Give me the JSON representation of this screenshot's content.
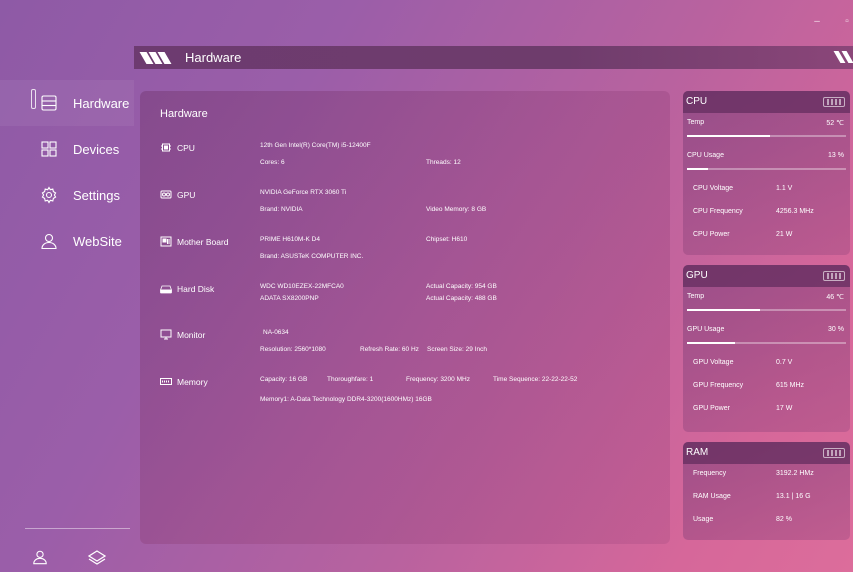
{
  "window": {
    "minimize_glyph": "–",
    "maximize_glyph": "▫"
  },
  "header": {
    "title": "Hardware"
  },
  "sidebar": {
    "items": [
      {
        "label": "Hardware",
        "icon": "hardware-icon",
        "active": true
      },
      {
        "label": "Devices",
        "icon": "devices-grid-icon"
      },
      {
        "label": "Settings",
        "icon": "gear-icon"
      },
      {
        "label": "WebSite",
        "icon": "user-icon"
      }
    ],
    "bottom_icons": [
      "user-icon",
      "layers-icon"
    ]
  },
  "main": {
    "title": "Hardware",
    "cpu": {
      "name": "CPU",
      "model": "12th Gen Intel(R) Core(TM) i5-12400F",
      "cores": "Cores: 6",
      "threads": "Threads: 12"
    },
    "gpu": {
      "name": "GPU",
      "model": "NVIDIA GeForce RTX 3060 Ti",
      "brand": "Brand: NVIDIA",
      "vram": "Video Memory: 8 GB"
    },
    "board": {
      "name": "Mother Board",
      "model": "PRIME H610M-K D4",
      "chipset": "Chipset: H610",
      "brand": "Brand: ASUSTeK COMPUTER INC."
    },
    "disk": {
      "name": "Hard Disk",
      "d1": "WDC WD10EZEX-22MFCA0",
      "d1cap": "Actual Capacity: 954 GB",
      "d2": "ADATA SX8200PNP",
      "d2cap": "Actual Capacity: 488 GB"
    },
    "monitor": {
      "name": "Monitor",
      "model": "NA-0634",
      "resolution": "Resolution: 2560*1080",
      "refresh": "Refresh Rate: 60 Hz",
      "size": "Screen Size: 29 Inch"
    },
    "memory": {
      "name": "Memory",
      "capacity": "Capacity: 16 GB",
      "thoroughfare": "Thoroughfare: 1",
      "frequency": "Frequency: 3200 MHz",
      "timing": "Time Sequence: 22-22-22-52",
      "module": "Memory1: A-Data Technology DDR4-3200(1600HMz) 16GB"
    }
  },
  "cards": {
    "cpu": {
      "title": "CPU",
      "temp_label": "Temp",
      "temp_value": "52 ℃",
      "temp_fraction": 0.52,
      "usage_label": "CPU Usage",
      "usage_value": "13 %",
      "usage_fraction": 0.13,
      "voltage_label": "CPU Voltage",
      "voltage": "1.1 V",
      "frequency_label": "CPU Frequency",
      "frequency": "4256.3 MHz",
      "power_label": "CPU Power",
      "power": "21 W"
    },
    "gpu": {
      "title": "GPU",
      "temp_label": "Temp",
      "temp_value": "46 ℃",
      "temp_fraction": 0.46,
      "usage_label": "GPU Usage",
      "usage_value": "30 %",
      "usage_fraction": 0.3,
      "voltage_label": "GPU Voltage",
      "voltage": "0.7 V",
      "frequency_label": "GPU Frequency",
      "frequency": "615 MHz",
      "power_label": "GPU Power",
      "power": "17 W"
    },
    "ram": {
      "title": "RAM",
      "frequency_label": "Frequency",
      "frequency": "3192.2 HMz",
      "usage_label": "RAM Usage",
      "usage": "13.1 | 16 G",
      "percent_label": "Usage",
      "percent": "82 %"
    }
  }
}
